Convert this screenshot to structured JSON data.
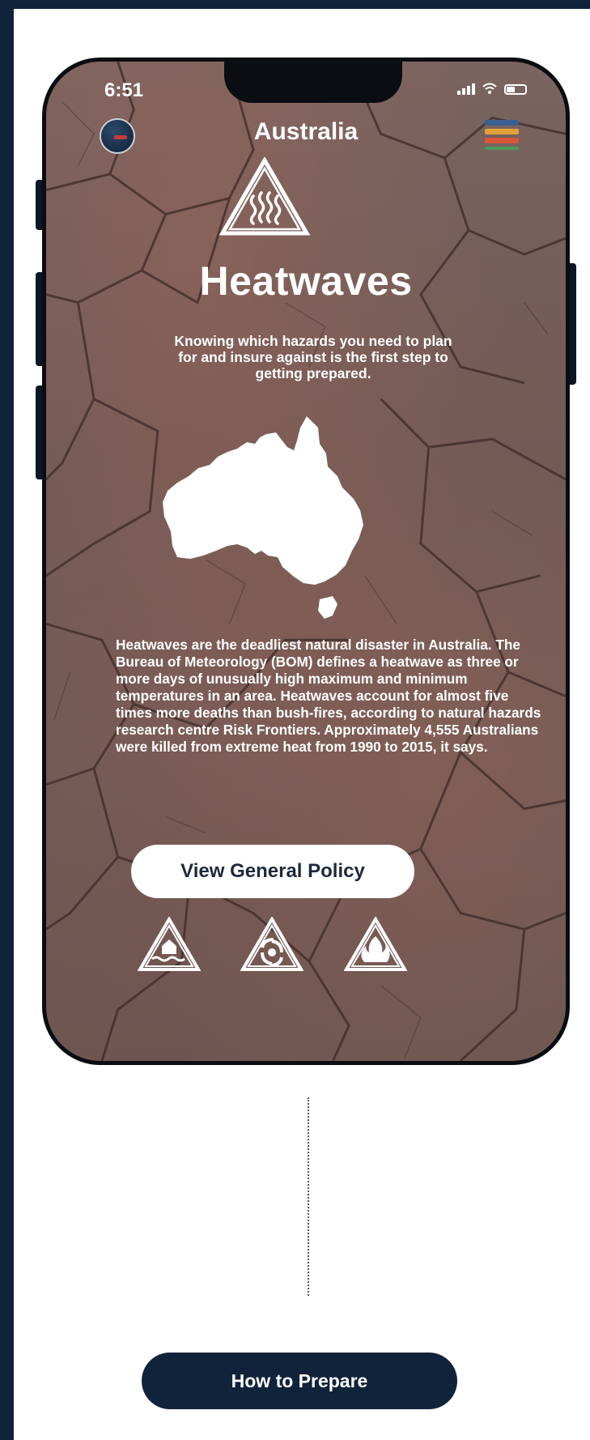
{
  "status_bar": {
    "time": "6:51"
  },
  "header": {
    "country": "Australia"
  },
  "hazard": {
    "title": "Heatwaves",
    "intro": "Knowing which hazards you need to plan for and insure against is the first step to getting prepared.",
    "description": "Heatwaves are the deadliest natural disaster in Australia. The Bureau of Meteorology (BOM) defines a heatwave as three or more days of unusually high maximum and minimum temperatures in an area. Heatwaves account for almost five times more deaths than bush-fires, according to natural hazards research centre Risk Frontiers. Approximately 4,555 Australians were killed from extreme heat from 1990 to 2015, it says."
  },
  "actions": {
    "view_policy": "View General Policy",
    "how_to_prepare": "How to Prepare"
  },
  "icons": {
    "main": "heatwave-warning-icon",
    "bottom": [
      "flood-warning-icon",
      "cyclone-warning-icon",
      "bushfire-warning-icon"
    ]
  },
  "colors": {
    "navy": "#11233a",
    "menu_stripes": [
      "#3b5f8f",
      "#e2a23a",
      "#d9563a",
      "#4c9a5b"
    ]
  }
}
